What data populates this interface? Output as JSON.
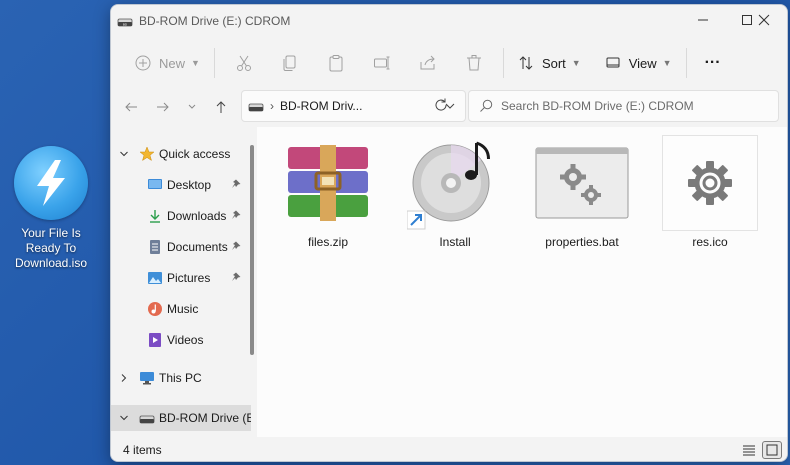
{
  "desktop": {
    "icon_name": "iso-file-icon",
    "label": "Your File Is Ready To Download.iso"
  },
  "window": {
    "title": "BD-ROM Drive (E:) CDROM",
    "controls": {
      "minimize": "minimize-icon",
      "maximize": "maximize-icon",
      "close": "close-icon"
    }
  },
  "toolbar": {
    "new_label": "New",
    "sort_label": "Sort",
    "view_label": "View",
    "more_label": "···"
  },
  "address": {
    "crumb": "BD-ROM Driv...",
    "search_placeholder": "Search BD-ROM Drive (E:) CDROM"
  },
  "sidebar": {
    "quick_access": "Quick access",
    "items": [
      {
        "label": "Desktop",
        "icon": "desktop-icon",
        "pinned": true
      },
      {
        "label": "Downloads",
        "icon": "download-icon",
        "pinned": true
      },
      {
        "label": "Documents",
        "icon": "document-icon",
        "pinned": true
      },
      {
        "label": "Pictures",
        "icon": "pictures-icon",
        "pinned": true
      },
      {
        "label": "Music",
        "icon": "music-icon",
        "pinned": false
      },
      {
        "label": "Videos",
        "icon": "videos-icon",
        "pinned": false
      }
    ],
    "this_pc": "This PC",
    "drive": "BD-ROM Drive (E"
  },
  "files": [
    {
      "name": "files.zip",
      "icon": "winrar-archive-icon"
    },
    {
      "name": "Install",
      "icon": "cd-music-shortcut-icon"
    },
    {
      "name": "properties.bat",
      "icon": "batch-file-icon"
    },
    {
      "name": "res.ico",
      "icon": "gear-icon"
    }
  ],
  "status": {
    "item_count": "4 items"
  },
  "colors": {
    "desktop_bg": "#2a63b3",
    "window_bg": "#f3f3f3",
    "content_bg": "#fcfcfc",
    "selected_bg": "#dcdcdc"
  }
}
